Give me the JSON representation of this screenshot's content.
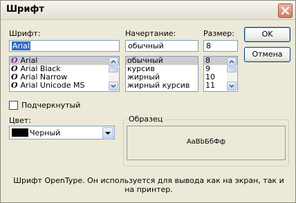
{
  "window": {
    "title": "Шрифт"
  },
  "font": {
    "label": "Шрифт:",
    "value": "Arial",
    "items": [
      "Arial",
      "Arial Black",
      "Arial Narrow",
      "Arial Unicode MS"
    ]
  },
  "style": {
    "label": "Начертание:",
    "value": "обычный",
    "items": [
      "обычный",
      "курсив",
      "жирный",
      "жирный курсив"
    ]
  },
  "size": {
    "label": "Размер:",
    "value": "8",
    "items": [
      "8",
      "9",
      "10",
      "11"
    ]
  },
  "buttons": {
    "ok": "OK",
    "cancel": "Отмена"
  },
  "underline": {
    "label": "Подчеркнутый",
    "checked": false
  },
  "color": {
    "label": "Цвет:",
    "value": "Черный",
    "swatch": "#000000"
  },
  "sample": {
    "legend": "Образец",
    "text": "AaBbБбФф"
  },
  "description": "Шрифт OpenType. Он используется для вывода как на экран, так и на принтер.",
  "colors": {
    "selection": "#316ac5",
    "border": "#7f9db9",
    "dialog_bg": "#ece9d8"
  }
}
